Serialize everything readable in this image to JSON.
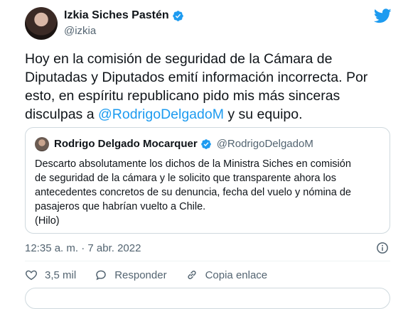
{
  "author": {
    "name": "Izkia Siches Pastén",
    "handle": "@izkia"
  },
  "tweet": {
    "text_before": "Hoy en la comisión de seguridad de la Cámara de Diputadas y Diputados emití información incorrecta. Por esto, en espíritu republicano pido mis más sinceras disculpas a ",
    "mention": "@RodrigoDelgadoM",
    "text_after": " y su equipo."
  },
  "quote": {
    "name": "Rodrigo Delgado Mocarquer",
    "handle": "@RodrigoDelgadoM",
    "text_line1": "Descarto absolutamente los dichos de la Ministra Siches en comisión",
    "text_line2": "de seguridad de la cámara y le solicito que transparente ahora los",
    "text_line3": "antecedentes concretos de su denuncia, fecha del vuelo y nómina de",
    "text_line4": "pasajeros que habrían vuelto a Chile.",
    "text_line5": "(Hilo)"
  },
  "meta": {
    "timestamp": "12:35 a. m. · 7 abr. 2022"
  },
  "actions": {
    "like_count": "3,5 mil",
    "reply_label": "Responder",
    "copy_label": "Copia enlace"
  },
  "icons": {
    "verified": "verified-badge-icon",
    "brand": "twitter-bird-icon",
    "info": "info-icon",
    "like": "heart-icon",
    "reply": "speech-bubble-icon",
    "copy": "link-icon"
  },
  "colors": {
    "accent": "#1d9bf0",
    "text": "#0f1419",
    "muted": "#536471",
    "border": "#cfd9de"
  }
}
